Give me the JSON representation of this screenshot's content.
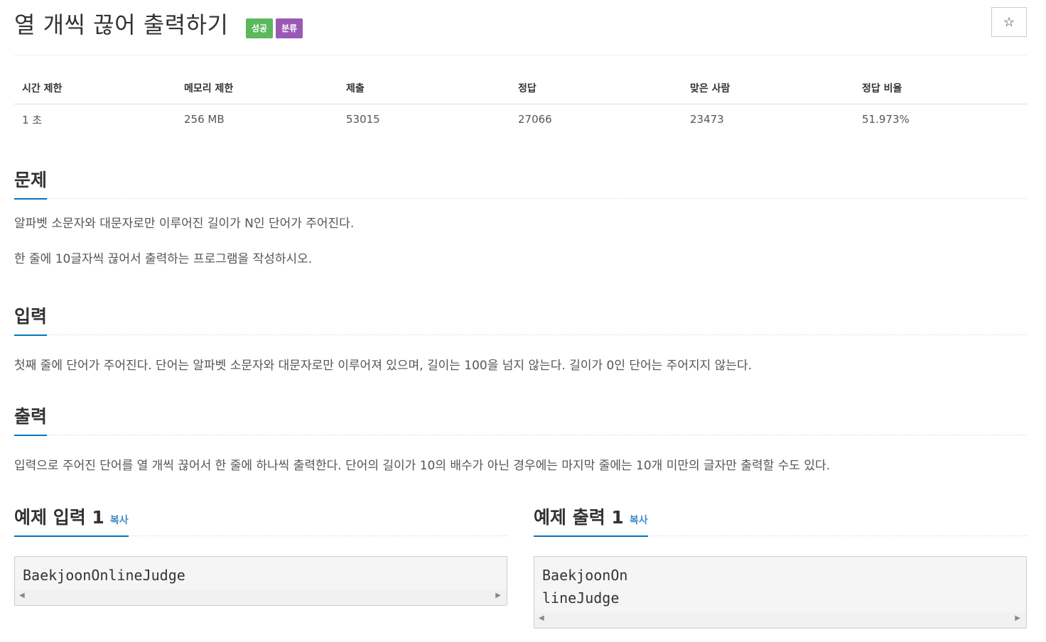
{
  "header": {
    "title": "열 개씩 끊어 출력하기",
    "badge_success": "성공",
    "badge_tag": "분류",
    "star_icon": "☆"
  },
  "stats": {
    "headers": [
      "시간 제한",
      "메모리 제한",
      "제출",
      "정답",
      "맞은 사람",
      "정답 비율"
    ],
    "values": [
      "1 초",
      "256 MB",
      "53015",
      "27066",
      "23473",
      "51.973%"
    ]
  },
  "problem": {
    "heading": "문제",
    "paragraphs": [
      "알파벳 소문자와 대문자로만 이루어진 길이가 N인 단어가 주어진다.",
      "한 줄에 10글자씩 끊어서 출력하는 프로그램을 작성하시오."
    ]
  },
  "input": {
    "heading": "입력",
    "text": "첫째 줄에 단어가 주어진다. 단어는 알파벳 소문자와 대문자로만 이루어져 있으며, 길이는 100을 넘지 않는다. 길이가 0인 단어는 주어지지 않는다."
  },
  "output": {
    "heading": "출력",
    "text": "입력으로 주어진 단어를 열 개씩 끊어서 한 줄에 하나씩 출력한다. 단어의 길이가 10의 배수가 아닌 경우에는 마지막 줄에는 10개 미만의 글자만 출력할 수도 있다."
  },
  "sample_input": {
    "heading": "예제 입력 1",
    "copy": "복사",
    "code": "BaekjoonOnlineJudge"
  },
  "sample_output": {
    "heading": "예제 출력 1",
    "copy": "복사",
    "code": "BaekjoonOn\nlineJudge"
  },
  "colors": {
    "success": "#5cb85c",
    "tag": "#9b59b6",
    "accent": "#0076c0",
    "link": "#428bca"
  }
}
